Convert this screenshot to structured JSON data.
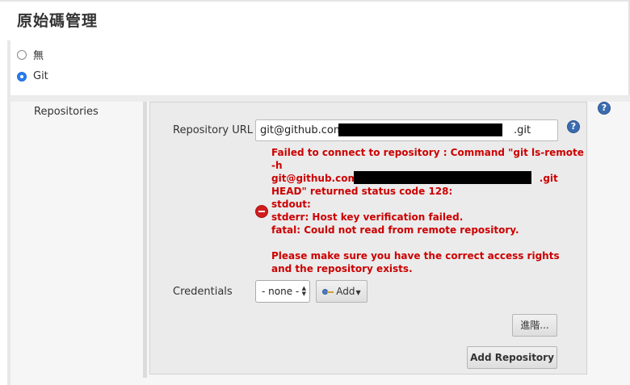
{
  "section": {
    "title": "原始碼管理"
  },
  "scm_options": [
    {
      "label": "無",
      "selected": false
    },
    {
      "label": "Git",
      "selected": true
    }
  ],
  "repositories": {
    "label": "Repositories",
    "url_label": "Repository URL",
    "url_value_prefix": "git@github.com:t",
    "url_value_suffix": ".git",
    "error_lines": [
      "Failed to connect to repository : Command \"git ls-remote",
      "-h",
      "git@github.com:",
      "HEAD\" returned status code 128:",
      "stdout:",
      "stderr: Host key verification failed.",
      "fatal: Could not read from remote repository.",
      "",
      "Please make sure you have the correct access rights",
      "and the repository exists."
    ],
    "error_git_suffix": ".git",
    "credentials_label": "Credentials",
    "credentials_value": "- none -",
    "add_label": "Add",
    "advanced_label": "進階...",
    "add_repository_label": "Add Repository",
    "help_glyph": "?"
  }
}
